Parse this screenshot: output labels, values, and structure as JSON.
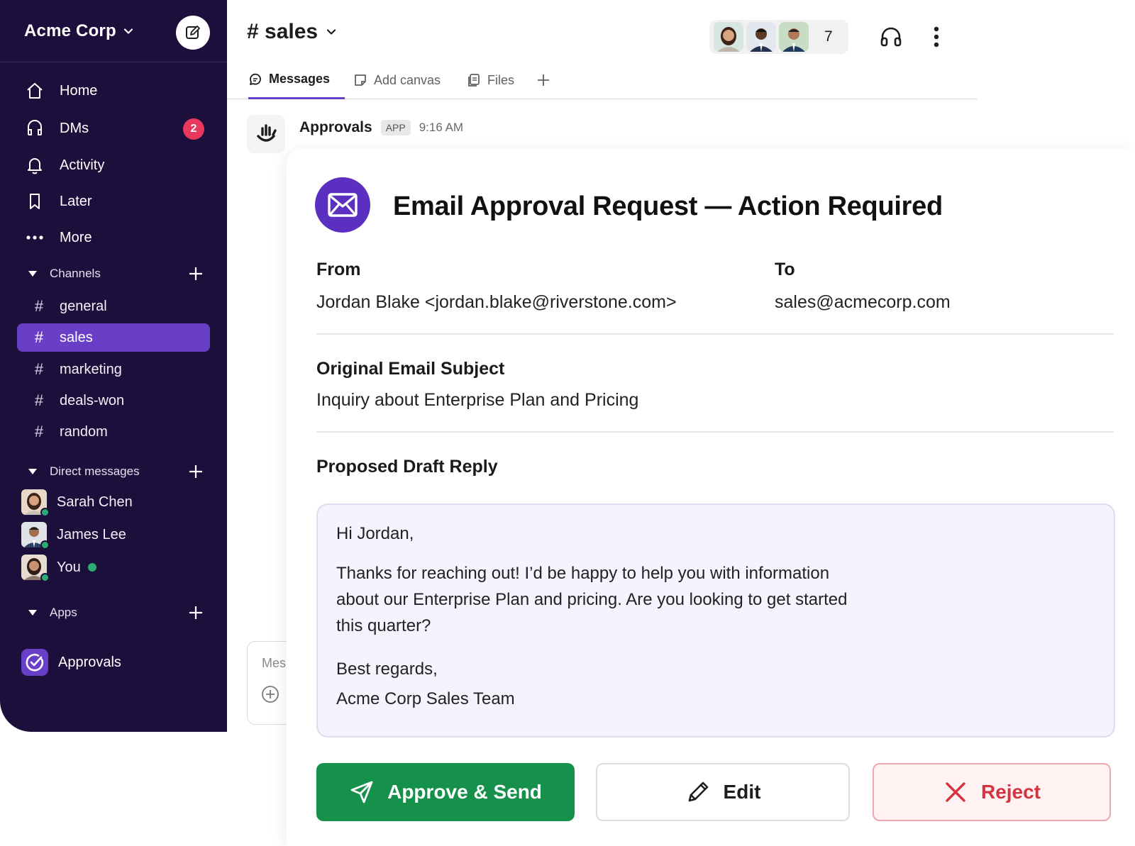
{
  "workspace": {
    "name": "Acme Corp"
  },
  "nav": [
    {
      "key": "home",
      "label": "Home"
    },
    {
      "key": "dms",
      "label": "DMs",
      "badge": "2"
    },
    {
      "key": "activity",
      "label": "Activity"
    },
    {
      "key": "later",
      "label": "Later"
    },
    {
      "key": "more",
      "label": "More"
    }
  ],
  "sections": {
    "channels": "Channels",
    "direct_messages": "Direct messages",
    "apps": "Apps"
  },
  "channels": [
    {
      "name": "general",
      "active": false
    },
    {
      "name": "sales",
      "active": true
    },
    {
      "name": "marketing",
      "active": false
    },
    {
      "name": "deals-won",
      "active": false
    },
    {
      "name": "random",
      "active": false
    }
  ],
  "dms": [
    {
      "name": "Sarah Chen"
    },
    {
      "name": "James Lee"
    },
    {
      "name": "You"
    }
  ],
  "apps": [
    {
      "name": "Approvals"
    }
  ],
  "header": {
    "channel_title": "# sales",
    "member_count": "7",
    "tabs": [
      {
        "label": "Messages",
        "icon": "messages-icon",
        "active": true
      },
      {
        "label": "Add canvas",
        "icon": "canvas-icon",
        "active": false
      },
      {
        "label": "Files",
        "icon": "files-icon",
        "active": false
      }
    ]
  },
  "message": {
    "sender": "Approvals",
    "tag": "APP",
    "time": "9:16 AM"
  },
  "card": {
    "title": "Email Approval Request — Action Required",
    "from_label": "From",
    "from_value": "Jordan Blake <jordan.blake@riverstone.com>",
    "to_label": "To",
    "to_value": "sales@acmecorp.com",
    "subject_label": "Original Email Subject",
    "subject_value": "Inquiry about Enterprise Plan and Pricing",
    "draft_label": "Proposed Draft Reply",
    "draft_lines": [
      "Hi Jordan,",
      "Thanks for reaching out! I’d be happy to help you with information",
      "about our Enterprise Plan and pricing. Are you looking to get started",
      "this quarter?",
      "Best regards,",
      "Acme Corp Sales Team"
    ],
    "buttons": {
      "approve": "Approve & Send",
      "edit": "Edit",
      "reject": "Reject"
    }
  },
  "composer": {
    "placeholder": "Mes"
  },
  "colors": {
    "sidebar_bg": "#1c0f3b",
    "accent": "#6a3fc8",
    "approve": "#16914c",
    "reject": "#d3343f",
    "badge": "#e8385c"
  }
}
